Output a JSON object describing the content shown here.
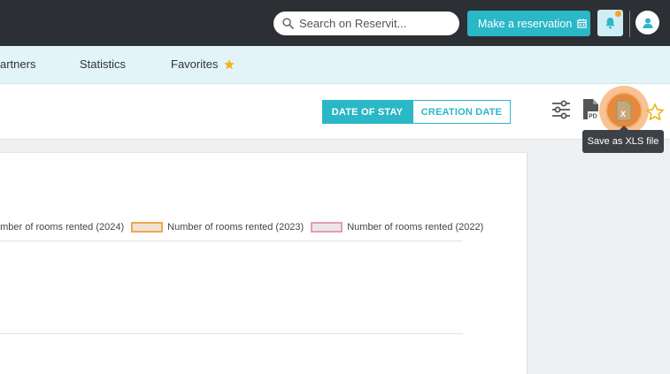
{
  "header": {
    "search_placeholder": "Search on Reservit...",
    "reserve_label": "Make a reservation"
  },
  "nav": {
    "partners": "artners",
    "statistics": "Statistics",
    "favorites": "Favorites"
  },
  "toolbar": {
    "date_of_stay": "DATE OF STAY",
    "creation_date": "CREATION DATE",
    "tooltip": "Save as XLS file"
  },
  "chart_data": {
    "type": "line",
    "series": [
      {
        "name": "umber of rooms rented (2024)",
        "values": []
      },
      {
        "name": "Number of rooms rented (2023)",
        "values": []
      },
      {
        "name": "Number of rooms rented (2022)",
        "values": []
      }
    ],
    "legend_placement": "top",
    "grid": true
  },
  "colors": {
    "accent": "#2ab7c6",
    "topbar": "#2c2f33",
    "series_2024": "#cccccc",
    "series_2023": "#f0a850",
    "series_2022": "#e0a0b8",
    "highlight": "#f3923c"
  },
  "icons": {
    "search": "search-icon",
    "calendar": "calendar-icon",
    "bell": "bell-icon",
    "user": "user-icon",
    "star": "star-icon",
    "filter": "sliders-icon",
    "pdf": "pdf-icon",
    "xls": "xls-icon"
  }
}
